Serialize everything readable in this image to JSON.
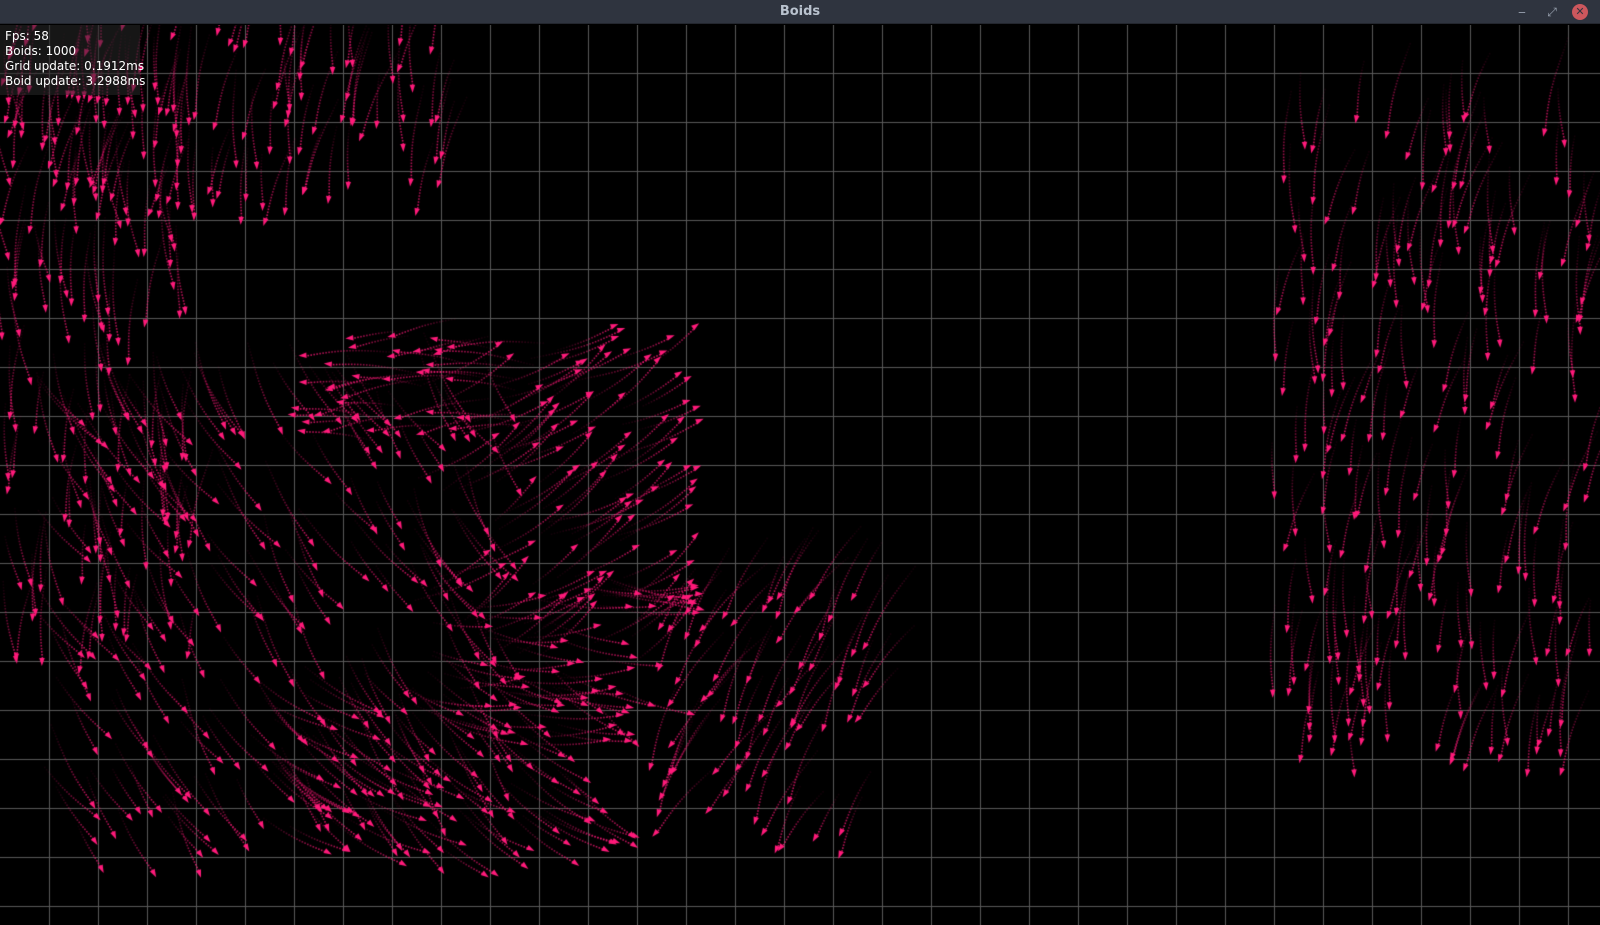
{
  "window": {
    "title": "Boids",
    "controls": {
      "minimize": "‒",
      "maximize": "⤢",
      "close": "✕"
    }
  },
  "stats": {
    "fps": "Fps: 58",
    "boids": "Boids: 1000",
    "grid_update": "Grid update: 0.1912ms",
    "boid_update": "Boid update: 3.2988ms"
  },
  "simulation": {
    "boid_count": 1000,
    "boid_color": "#ff1a7a",
    "grid_color": "#5a5a5a",
    "background_color": "#000000"
  }
}
